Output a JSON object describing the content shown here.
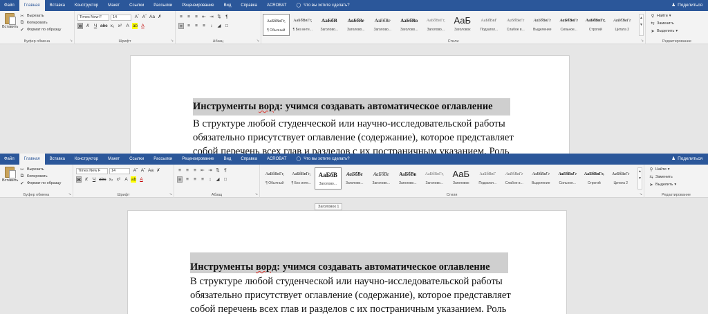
{
  "tabs": [
    "Файл",
    "Главная",
    "Вставка",
    "Конструктор",
    "Макет",
    "Ссылки",
    "Рассылки",
    "Рецензирование",
    "Вид",
    "Справка",
    "ACROBAT"
  ],
  "tell_me": "Что вы хотите сделать?",
  "share": "Поделиться",
  "clipboard": {
    "paste": "Вставить",
    "cut": "Вырезать",
    "copy": "Копировать",
    "format_painter": "Формат по образцу",
    "label": "Буфер обмена"
  },
  "font": {
    "name": "Times New F",
    "size": "14",
    "label": "Шрифт"
  },
  "paragraph": {
    "label": "Абзац"
  },
  "styles": {
    "label": "Стили",
    "items": [
      {
        "sample": "АаБбВвГг,",
        "name": "¶ Обычный"
      },
      {
        "sample": "АаБбВвГг,",
        "name": "¶ Без инте..."
      },
      {
        "sample": "АаБбВ",
        "name": "Заголово..."
      },
      {
        "sample": "АаБбВе",
        "name": "Заголово..."
      },
      {
        "sample": "АаБбВе",
        "name": "Заголово..."
      },
      {
        "sample": "АаБбВв",
        "name": "Заголово..."
      },
      {
        "sample": "АаБбВвГг,",
        "name": "Заголово..."
      },
      {
        "sample": "АаБ",
        "name": "Заголовок"
      },
      {
        "sample": "АаБбВвГ",
        "name": "Подзагол..."
      },
      {
        "sample": "АаБбВвГг",
        "name": "Слабое в..."
      },
      {
        "sample": "АаБбВвГг",
        "name": "Выделение"
      },
      {
        "sample": "АаБбВвГг",
        "name": "Сильное..."
      },
      {
        "sample": "АаБбВвГг,",
        "name": "Строгий"
      },
      {
        "sample": "АаБбВвГг",
        "name": "Цитата 2"
      }
    ]
  },
  "editing": {
    "find": "Найти",
    "replace": "Заменить",
    "select": "Выделить",
    "label": "Редактирование"
  },
  "tooltip": "Заголовок 1",
  "document": {
    "heading_before": "Инструменты ",
    "heading_squiggle": "ворд",
    "heading_after": ": учимся создавать автоматическое оглавление",
    "lines": [
      "В структуре любой студенческой или научно-исследовательской работы",
      "обязательно присутствует оглавление (содержание), которое представляет",
      "собой перечень всех глав и разделов с их постраничным указанием. Роль"
    ]
  },
  "colors": {
    "accent": "#2b579a",
    "ribbon": "#f3f3f3",
    "workspace": "#e6e6e6",
    "heading_highlight": "#cfcfcf"
  }
}
